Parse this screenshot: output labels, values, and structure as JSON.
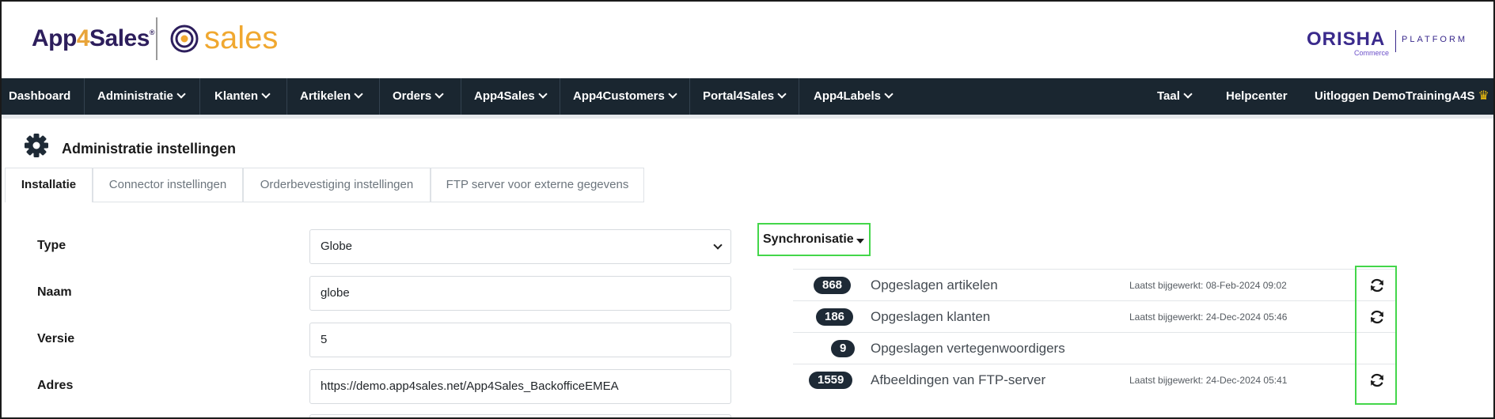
{
  "header": {
    "brand_app": "App",
    "brand_four": "4",
    "brand_sales": "Sales",
    "brand_reg": "®",
    "brand_module": "sales",
    "partner_name": "ORISHA",
    "partner_sub": "Commerce",
    "partner_platform": "PLATFORM"
  },
  "navbar": {
    "left": [
      {
        "label": "Dashboard",
        "dropdown": false
      },
      {
        "label": "Administratie",
        "dropdown": true
      },
      {
        "label": "Klanten",
        "dropdown": true
      },
      {
        "label": "Artikelen",
        "dropdown": true
      },
      {
        "label": "Orders",
        "dropdown": true
      },
      {
        "label": "App4Sales",
        "dropdown": true
      },
      {
        "label": "App4Customers",
        "dropdown": true
      },
      {
        "label": "Portal4Sales",
        "dropdown": true
      },
      {
        "label": "App4Labels",
        "dropdown": true
      }
    ],
    "language": "Taal",
    "help": "Helpcenter",
    "logout_prefix": "Uitloggen",
    "logout_user": "DemoTrainingA4S",
    "crown_icon": "crown-icon"
  },
  "page": {
    "title": "Administratie instellingen",
    "icon": "gear-icon"
  },
  "tabs": [
    {
      "label": "Installatie",
      "active": true
    },
    {
      "label": "Connector instellingen",
      "active": false
    },
    {
      "label": "Orderbevestiging instellingen",
      "active": false
    },
    {
      "label": "FTP server voor externe gegevens",
      "active": false
    }
  ],
  "form": {
    "type_label": "Type",
    "type_value": "Globe",
    "name_label": "Naam",
    "name_value": "globe",
    "version_label": "Versie",
    "version_value": "5",
    "address_label": "Adres",
    "address_value": "https://demo.app4sales.net/App4Sales_BackofficeEMEA"
  },
  "sync": {
    "title": "Synchronisatie",
    "rows": [
      {
        "count": "868",
        "label": "Opgeslagen artikelen",
        "updated": "Laatst bijgewerkt: 08-Feb-2024 09:02",
        "refresh": true
      },
      {
        "count": "186",
        "label": "Opgeslagen klanten",
        "updated": "Laatst bijgewerkt: 24-Dec-2024 05:46",
        "refresh": true
      },
      {
        "count": "9",
        "label": "Opgeslagen vertegenwoordigers",
        "updated": "",
        "refresh": false
      },
      {
        "count": "1559",
        "label": "Afbeeldingen van FTP-server",
        "updated": "Laatst bijgewerkt: 24-Dec-2024 05:41",
        "refresh": true
      }
    ]
  },
  "colors": {
    "navbar_bg": "#1a2630",
    "brand_purple": "#2d1e5c",
    "brand_orange": "#f0a830",
    "highlight_green": "#43d64a",
    "badge_bg": "#1e2a36"
  }
}
